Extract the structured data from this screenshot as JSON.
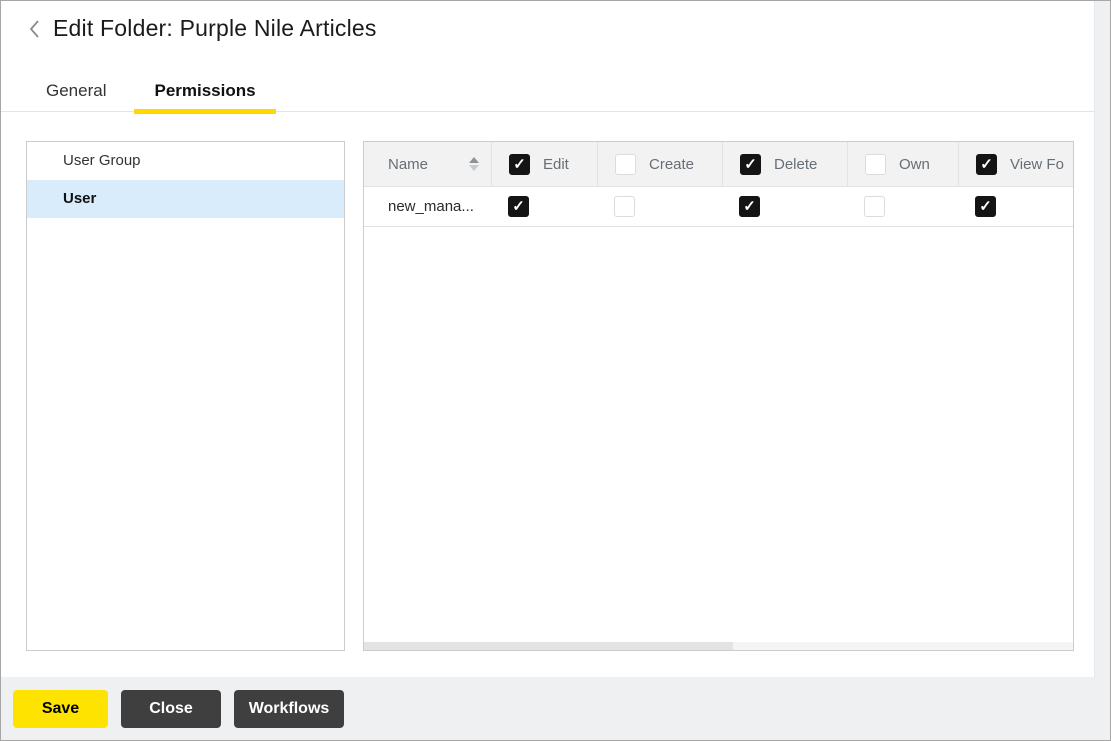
{
  "header": {
    "title": "Edit Folder: Purple Nile Articles",
    "back_icon": "chevron-left"
  },
  "tabs": [
    {
      "label": "General",
      "active": false
    },
    {
      "label": "Permissions",
      "active": true
    }
  ],
  "sidebar": {
    "items": [
      {
        "label": "User Group",
        "selected": false
      },
      {
        "label": "User",
        "selected": true
      }
    ]
  },
  "table": {
    "columns": [
      {
        "label": "Name",
        "type": "text",
        "sortable": true
      },
      {
        "label": "Edit",
        "type": "checkbox",
        "checked": true
      },
      {
        "label": "Create",
        "type": "checkbox",
        "checked": false
      },
      {
        "label": "Delete",
        "type": "checkbox",
        "checked": true
      },
      {
        "label": "Own",
        "type": "checkbox",
        "checked": false
      },
      {
        "label": "View Fo",
        "type": "checkbox",
        "checked": true
      }
    ],
    "rows": [
      {
        "name": "new_mana...",
        "permissions": {
          "edit": true,
          "create": false,
          "delete": true,
          "own": false,
          "view": true
        }
      }
    ],
    "h_scroll_thumb_percent": 52
  },
  "footer": {
    "buttons": [
      {
        "label": "Save",
        "style": "primary"
      },
      {
        "label": "Close",
        "style": "dark"
      },
      {
        "label": "Workflows",
        "style": "dark"
      }
    ]
  },
  "colors": {
    "accent_yellow": "#ffd800",
    "save_button_yellow": "#ffe300",
    "dark_button": "#3f3f3f",
    "selected_item_blue": "#d9ecfc",
    "table_header_bg": "#f2f2f2",
    "footer_bg": "#eef0f2",
    "checkbox_checked": "#141414",
    "window_border": "#a6a6a6"
  }
}
